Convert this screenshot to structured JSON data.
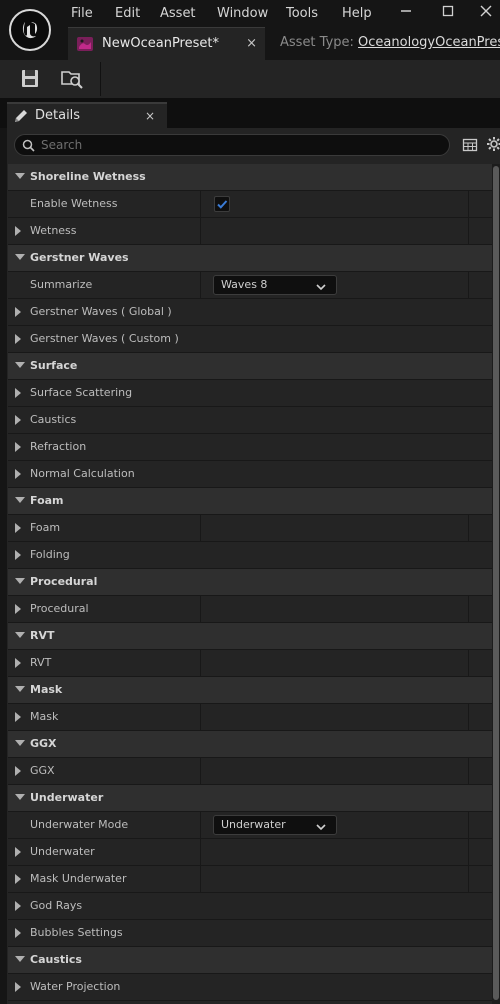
{
  "menu": [
    "File",
    "Edit",
    "Asset",
    "Window",
    "Tools",
    "Help"
  ],
  "document_tab": {
    "label": "NewOceanPreset*",
    "close": "×"
  },
  "asset_type": {
    "prefix": "Asset Type: ",
    "value": "OceanologyOceanPreset"
  },
  "panel": {
    "title": "Details",
    "close": "×"
  },
  "search": {
    "placeholder": "Search"
  },
  "rows": [
    {
      "type": "category",
      "label": "Shoreline Wetness"
    },
    {
      "type": "prop",
      "label": "Enable Wetness",
      "widget": "checkbox",
      "checked": true
    },
    {
      "type": "prop",
      "label": "Wetness",
      "expand": true,
      "split": true
    },
    {
      "type": "category",
      "label": "Gerstner Waves"
    },
    {
      "type": "prop",
      "label": "Summarize",
      "widget": "combo",
      "value": "Waves 8"
    },
    {
      "type": "prop",
      "label": "Gerstner Waves ( Global )",
      "expand": true
    },
    {
      "type": "prop",
      "label": "Gerstner Waves ( Custom )",
      "expand": true
    },
    {
      "type": "category",
      "label": "Surface"
    },
    {
      "type": "prop",
      "label": "Surface Scattering",
      "expand": true
    },
    {
      "type": "prop",
      "label": "Caustics",
      "expand": true
    },
    {
      "type": "prop",
      "label": "Refraction",
      "expand": true
    },
    {
      "type": "prop",
      "label": "Normal Calculation",
      "expand": true
    },
    {
      "type": "category",
      "label": "Foam"
    },
    {
      "type": "prop",
      "label": "Foam",
      "expand": true,
      "split": true
    },
    {
      "type": "prop",
      "label": "Folding",
      "expand": true
    },
    {
      "type": "category",
      "label": "Procedural"
    },
    {
      "type": "prop",
      "label": "Procedural",
      "expand": true,
      "split": true
    },
    {
      "type": "category",
      "label": "RVT"
    },
    {
      "type": "prop",
      "label": "RVT",
      "expand": true,
      "split": true
    },
    {
      "type": "category",
      "label": "Mask"
    },
    {
      "type": "prop",
      "label": "Mask",
      "expand": true,
      "split": true
    },
    {
      "type": "category",
      "label": "GGX"
    },
    {
      "type": "prop",
      "label": "GGX",
      "expand": true,
      "split": true
    },
    {
      "type": "category",
      "label": "Underwater"
    },
    {
      "type": "prop",
      "label": "Underwater Mode",
      "widget": "combo",
      "value": "Underwater"
    },
    {
      "type": "prop",
      "label": "Underwater",
      "expand": true,
      "split": true
    },
    {
      "type": "prop",
      "label": "Mask Underwater",
      "expand": true,
      "split": true
    },
    {
      "type": "prop",
      "label": "God Rays",
      "expand": true
    },
    {
      "type": "prop",
      "label": "Bubbles Settings",
      "expand": true
    },
    {
      "type": "category",
      "label": "Caustics"
    },
    {
      "type": "prop",
      "label": "Water Projection",
      "expand": true
    }
  ],
  "colors": {
    "accent": "#3a7bd5",
    "background": "#242424",
    "category_bg": "#2f2f2f"
  }
}
